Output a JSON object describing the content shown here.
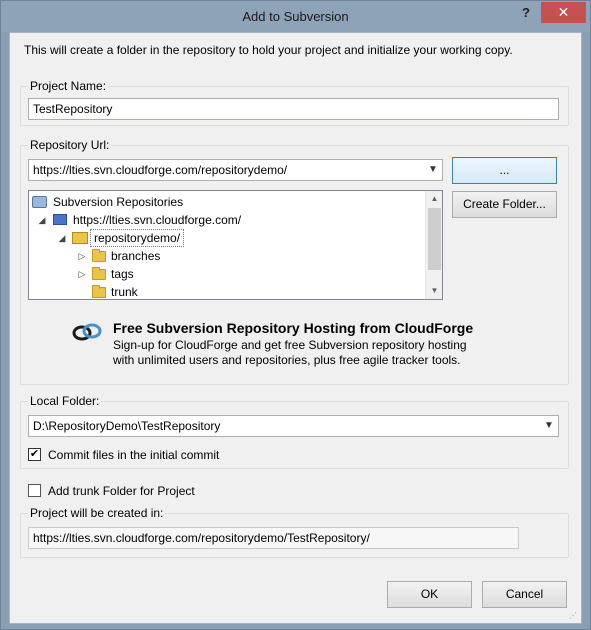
{
  "window": {
    "title": "Add to Subversion",
    "help_label": "?",
    "close_label": "✕"
  },
  "intro_text": "This will create a folder in the repository to hold your project and initialize your working copy.",
  "project_name": {
    "label": "Project Name:",
    "value": "TestRepository"
  },
  "repository": {
    "label": "Repository Url:",
    "url_value": "https://lties.svn.cloudforge.com/repositorydemo/",
    "browse_label": "...",
    "create_folder_label": "Create Folder...",
    "tree": [
      {
        "label": "Subversion Repositories",
        "icon": "repositories-icon"
      },
      {
        "label": "https://lties.svn.cloudforge.com/",
        "icon": "server-icon"
      },
      {
        "label": "repositorydemo/",
        "icon": "repository-icon"
      },
      {
        "label": "branches",
        "icon": "folder-icon"
      },
      {
        "label": "tags",
        "icon": "folder-icon"
      },
      {
        "label": "trunk",
        "icon": "folder-icon"
      }
    ]
  },
  "promo": {
    "title": "Free Subversion Repository Hosting from CloudForge",
    "line1": "Sign-up for CloudForge and get free Subversion repository hosting",
    "line2": "with unlimited users and repositories, plus free agile tracker tools."
  },
  "local_folder": {
    "label": "Local Folder:",
    "value": "D:\\RepositoryDemo\\TestRepository",
    "commit_label": "Commit files in the initial commit",
    "commit_checked": true
  },
  "trunk": {
    "label": "Add trunk Folder for Project",
    "checked": false
  },
  "created_in": {
    "label": "Project will be created in:",
    "value": "https://lties.svn.cloudforge.com/repositorydemo/TestRepository/"
  },
  "buttons": {
    "ok": "OK",
    "cancel": "Cancel"
  },
  "colors": {
    "title_bar": "#8fa3b8",
    "close_button": "#c75050",
    "client_bg": "#f0f0f0"
  }
}
